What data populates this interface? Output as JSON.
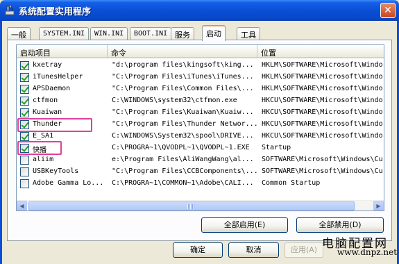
{
  "window": {
    "title": "系统配置实用程序",
    "close_glyph": "✕"
  },
  "tabs": [
    {
      "label": "一般"
    },
    {
      "label": "SYSTEM.INI"
    },
    {
      "label": "WIN.INI"
    },
    {
      "label": "BOOT.INI"
    },
    {
      "label": "服务"
    },
    {
      "label": "启动"
    },
    {
      "label": "工具"
    }
  ],
  "active_tab": "启动",
  "list": {
    "columns": [
      "启动项目",
      "命令",
      "位置"
    ],
    "rows": [
      {
        "checked": true,
        "name": "kxetray",
        "command": "\"d:\\program files\\kingsoft\\king...",
        "location": "HKLM\\SOFTWARE\\Microsoft\\Windo"
      },
      {
        "checked": true,
        "name": "iTunesHelper",
        "command": "\"C:\\Program Files\\iTunes\\iTunes...",
        "location": "HKLM\\SOFTWARE\\Microsoft\\Windo"
      },
      {
        "checked": true,
        "name": "APSDaemon",
        "command": "\"C:\\Program Files\\Common Files\\...",
        "location": "HKLM\\SOFTWARE\\Microsoft\\Windo"
      },
      {
        "checked": true,
        "name": "ctfmon",
        "command": "C:\\WINDOWS\\system32\\ctfmon.exe",
        "location": "HKCU\\SOFTWARE\\Microsoft\\Windo"
      },
      {
        "checked": true,
        "name": "Kuaiwan",
        "command": "\"C:\\Program Files\\Kuaiwan\\Kuaiw...",
        "location": "HKCU\\SOFTWARE\\Microsoft\\Windo"
      },
      {
        "checked": true,
        "name": "Thunder",
        "command": "\"C:\\Program Files\\Thunder Networ...",
        "location": "HKCU\\SOFTWARE\\Microsoft\\Windo"
      },
      {
        "checked": true,
        "name": "E_SA1",
        "command": "C:\\WINDOWS\\System32\\spool\\DRIVE...",
        "location": "HKCU\\SOFTWARE\\Microsoft\\Windo"
      },
      {
        "checked": true,
        "name": "快播",
        "command": "C:\\PROGRA~1\\QVODPL~1\\QVODPL~1.EXE",
        "location": "Startup"
      },
      {
        "checked": false,
        "name": "aliim",
        "command": "e:\\Program Files\\AliWangWang\\al...",
        "location": "SOFTWARE\\Microsoft\\Windows\\Cu"
      },
      {
        "checked": false,
        "name": "USBKeyTools",
        "command": "\"C:\\Program Files\\CCBComponents\\...",
        "location": "SOFTWARE\\Microsoft\\Windows\\Cu"
      },
      {
        "checked": false,
        "name": "Adobe Gamma Lo...",
        "command": "C:\\PROGRA~1\\COMMON~1\\Adobe\\CALI...",
        "location": "Common Startup"
      }
    ]
  },
  "scrollbar": {
    "left_arrow": "◀",
    "right_arrow": "▶"
  },
  "buttons": {
    "enable_all": "全部启用(E)",
    "disable_all": "全部禁用(D)",
    "ok": "确定",
    "cancel": "取消",
    "apply": "应用(A)"
  },
  "watermark": {
    "top": "电脑配置网",
    "bottom": "www.dnpz.net"
  },
  "colors": {
    "title_bar": "#0a4fd6",
    "highlight_box": "#e0409a",
    "check_mark": "#21a121"
  }
}
